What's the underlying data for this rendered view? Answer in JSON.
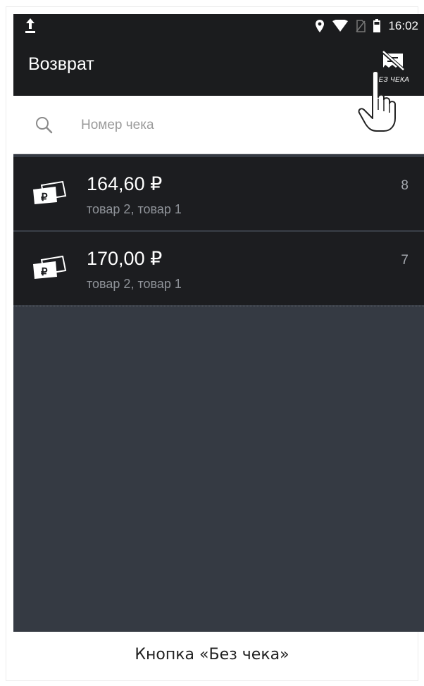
{
  "status_bar": {
    "time": "16:02",
    "icons": [
      "upload-icon",
      "location-icon",
      "wifi-icon",
      "no-sim-icon",
      "battery-icon"
    ]
  },
  "app_bar": {
    "title": "Возврат",
    "no_receipt_label": "БЕЗ ЧЕКА",
    "no_receipt_icon": "no-receipt-icon"
  },
  "search": {
    "placeholder": "Номер чека",
    "value": ""
  },
  "receipts": [
    {
      "amount": "164,60 ₽",
      "items": "товар 2, товар 1",
      "number": "8",
      "icon": "money-icon"
    },
    {
      "amount": "170,00 ₽",
      "items": "товар 2, товар 1",
      "number": "7",
      "icon": "money-icon"
    }
  ],
  "caption": "Кнопка «Без чека»",
  "colors": {
    "bar": "#1b1c1e",
    "background": "#353a43",
    "list_item": "#1c1d20",
    "text_primary": "#ffffff",
    "text_secondary": "#8f9399"
  }
}
